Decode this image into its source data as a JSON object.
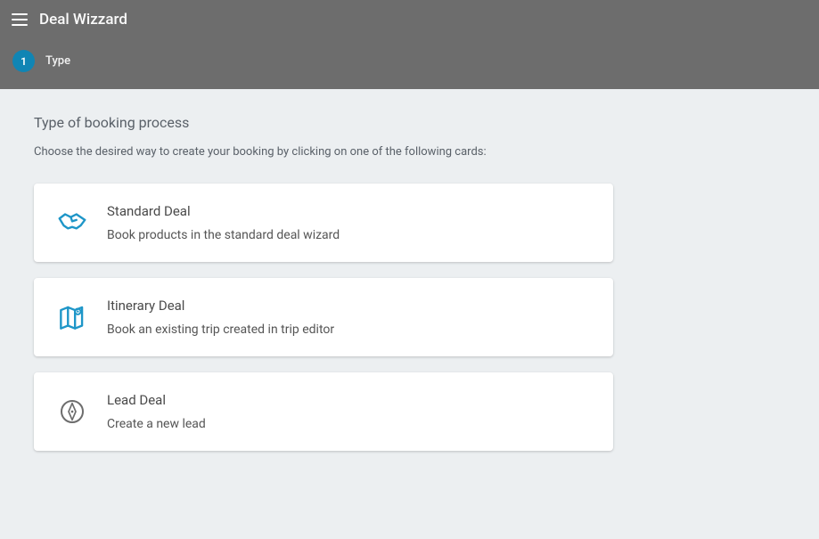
{
  "header": {
    "title": "Deal Wizzard"
  },
  "stepper": {
    "current": {
      "number": "1",
      "label": "Type"
    }
  },
  "section": {
    "title": "Type of booking process",
    "description": "Choose the desired way to create your booking by clicking on one of the following cards:"
  },
  "cards": [
    {
      "title": "Standard Deal",
      "description": "Book products in the standard deal wizard"
    },
    {
      "title": "Itinerary Deal",
      "description": "Book an existing trip created in trip editor"
    },
    {
      "title": "Lead Deal",
      "description": "Create a new lead"
    }
  ],
  "colors": {
    "accent": "#1085b4",
    "iconBlue": "#1e96c8",
    "iconGray": "#6d6d6d"
  }
}
